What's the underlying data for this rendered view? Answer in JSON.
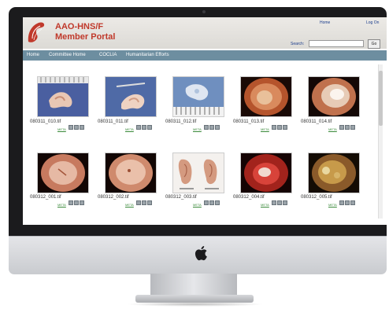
{
  "site": {
    "title_line1": "AAO-HNS/F",
    "title_line2": "Member Portal",
    "home_link": "Home",
    "logout_link": "Log On",
    "search_label": "Search:",
    "search_value": "",
    "go_label": "Go"
  },
  "nav": [
    "Home",
    "Committee Home",
    "COCLIA",
    "Humanitarian Efforts"
  ],
  "gallery": {
    "row1": [
      {
        "filename": "080311_010.tif",
        "meta": "META",
        "kind": "specimen1"
      },
      {
        "filename": "080311_011.tif",
        "meta": "META",
        "kind": "specimen2"
      },
      {
        "filename": "080311_012.tif",
        "meta": "META",
        "kind": "specimen3"
      },
      {
        "filename": "080311_013.tif",
        "meta": "META",
        "kind": "ear-red"
      },
      {
        "filename": "080311_014.tif",
        "meta": "META",
        "kind": "ear-white"
      }
    ],
    "row2": [
      {
        "filename": "080312_001.tif",
        "meta": "META",
        "kind": "ear-pink"
      },
      {
        "filename": "080312_002.tif",
        "meta": "META",
        "kind": "ear-pink2"
      },
      {
        "filename": "080312_003.tif",
        "meta": "META",
        "kind": "ears-external"
      },
      {
        "filename": "080312_004.tif",
        "meta": "META",
        "kind": "ear-inflamed"
      },
      {
        "filename": "080312_005.tif",
        "meta": "META",
        "kind": "ear-yellow"
      }
    ]
  },
  "colors": {
    "brand_red": "#c0392b",
    "nav_bar": "#6d8ea0",
    "meta_green": "#3a8a3a"
  }
}
